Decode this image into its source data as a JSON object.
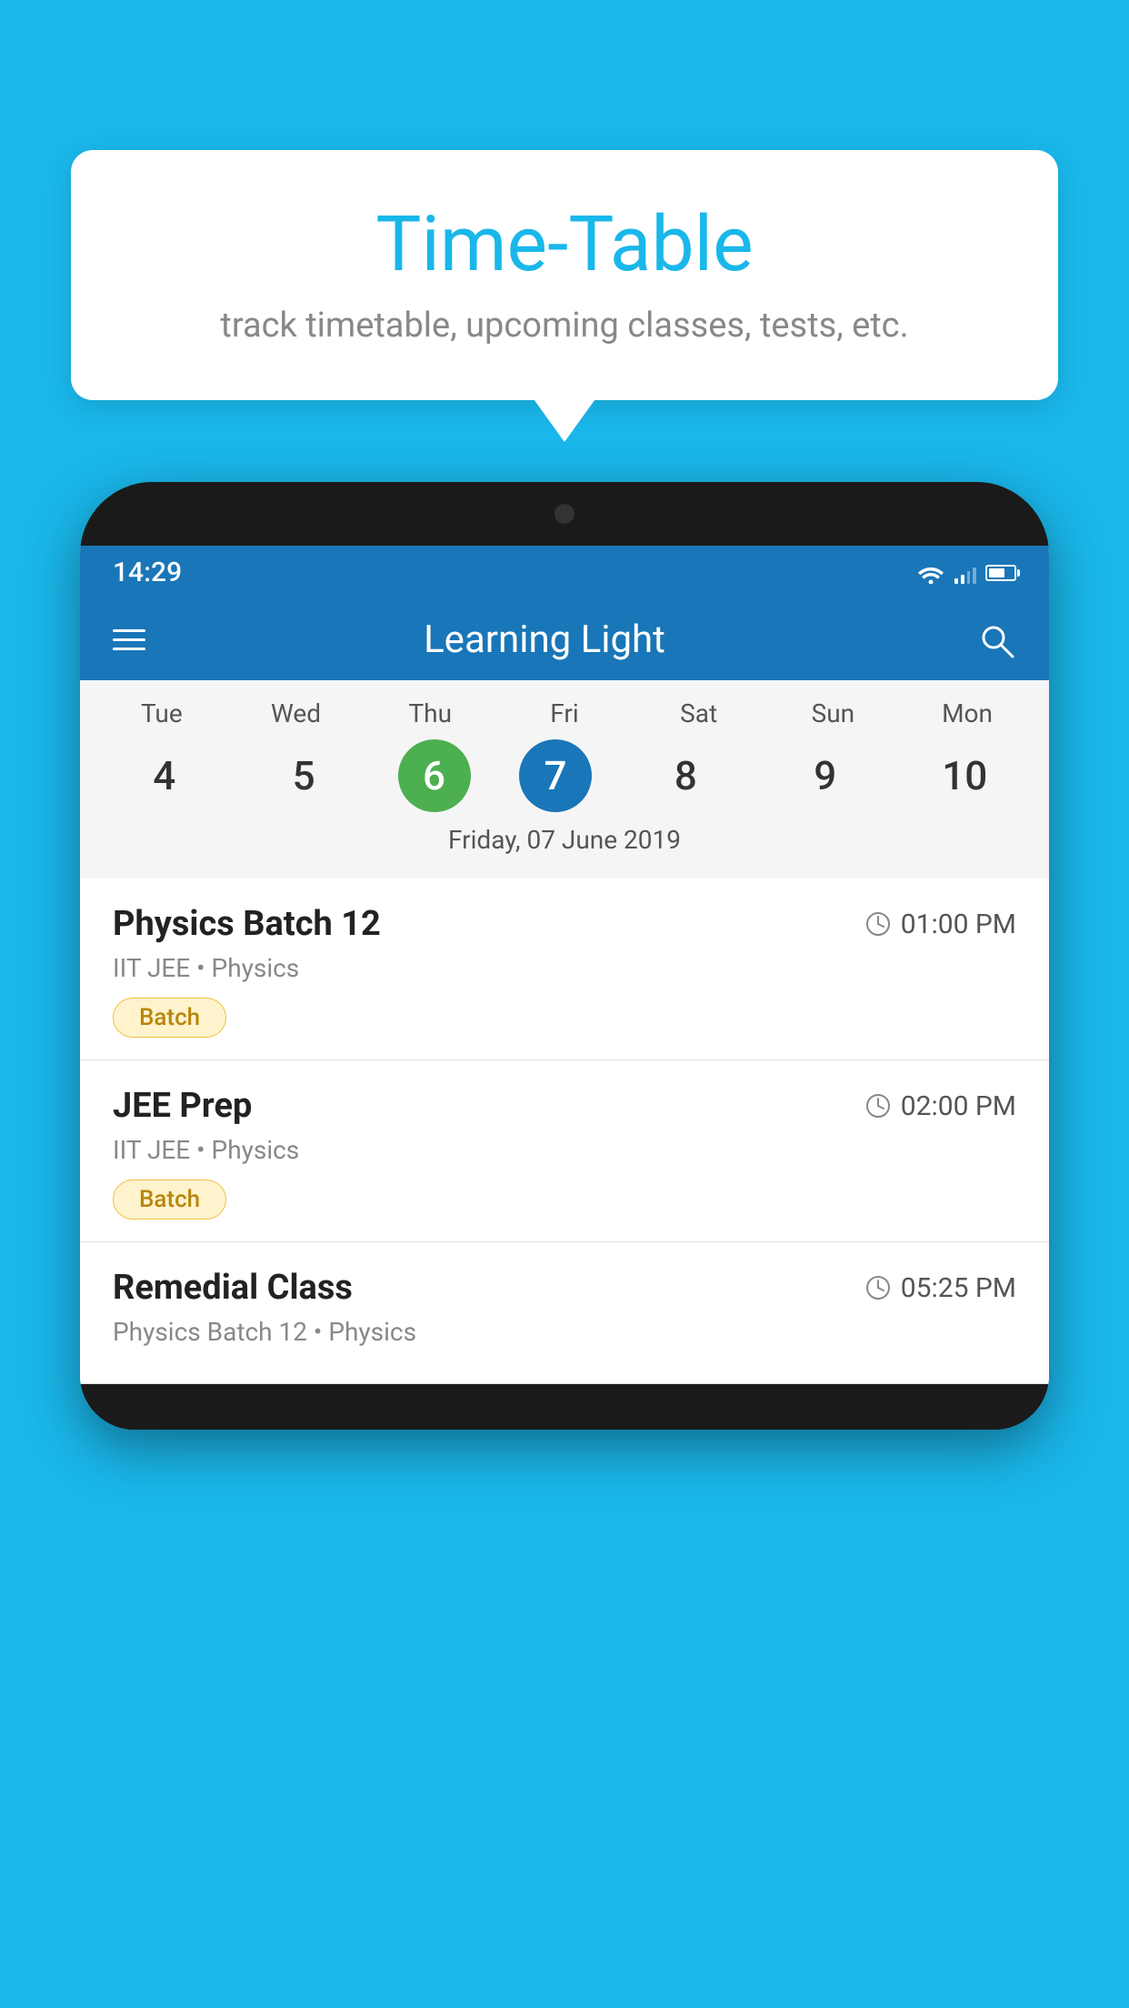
{
  "background_color": "#1ab7ea",
  "bubble": {
    "title": "Time-Table",
    "subtitle": "track timetable, upcoming classes, tests, etc."
  },
  "app": {
    "title": "Learning Light",
    "status_time": "14:29"
  },
  "calendar": {
    "days": [
      {
        "name": "Tue",
        "num": "4",
        "state": "normal"
      },
      {
        "name": "Wed",
        "num": "5",
        "state": "normal"
      },
      {
        "name": "Thu",
        "num": "6",
        "state": "today"
      },
      {
        "name": "Fri",
        "num": "7",
        "state": "selected"
      },
      {
        "name": "Sat",
        "num": "8",
        "state": "normal"
      },
      {
        "name": "Sun",
        "num": "9",
        "state": "normal"
      },
      {
        "name": "Mon",
        "num": "10",
        "state": "normal"
      }
    ],
    "selected_date_label": "Friday, 07 June 2019"
  },
  "events": [
    {
      "title": "Physics Batch 12",
      "time": "01:00 PM",
      "subtitle": "IIT JEE • Physics",
      "tag": "Batch"
    },
    {
      "title": "JEE Prep",
      "time": "02:00 PM",
      "subtitle": "IIT JEE • Physics",
      "tag": "Batch"
    },
    {
      "title": "Remedial Class",
      "time": "05:25 PM",
      "subtitle": "Physics Batch 12 • Physics",
      "tag": null
    }
  ]
}
